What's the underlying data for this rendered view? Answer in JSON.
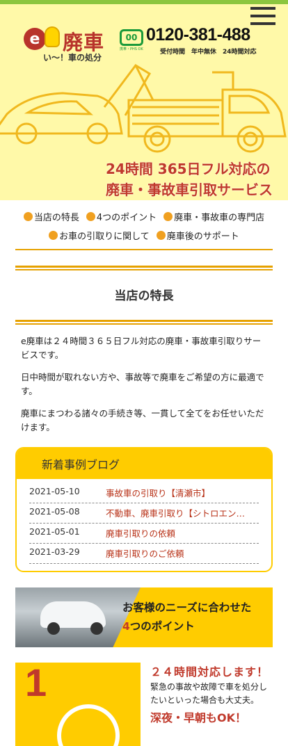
{
  "header": {
    "logo_letter": "e",
    "logo_word": "廃車",
    "logo_tagline": "い～！車の処分",
    "freedial_mark": "00",
    "freedial_sub": "携帯・PHS OK",
    "phone": "0120-381-488",
    "hours": "受付時間　年中無休　24時間対応",
    "hero_line1": "24時間 365日フル対応の",
    "hero_line2": "廃車・事故車引取サービス"
  },
  "nav": {
    "row1": [
      "当店の特長",
      "4つのポイント",
      "廃車・事故車の専門店"
    ],
    "row2": [
      "お車の引取りに関して",
      "廃車後のサポート"
    ]
  },
  "features": {
    "heading": "当店の特長",
    "paragraphs": [
      "e廃車は２４時間３６５日フル対応の廃車・事故車引取りサービスです。",
      "日中時間が取れない方や、事故等で廃車をご希望の方に最適です。",
      "廃車にまつわる諸々の手続き等、一貫して全てをお任せいただけます。"
    ]
  },
  "blog": {
    "heading": "新着事例ブログ",
    "entries": [
      {
        "date": "2021-05-10",
        "title": "事故車の引取り【清瀬市】"
      },
      {
        "date": "2021-05-08",
        "title": "不動車、廃車引取り【シトロエン…"
      },
      {
        "date": "2021-05-01",
        "title": "廃車引取りの依頼"
      },
      {
        "date": "2021-03-29",
        "title": "廃車引取りのご依頼"
      }
    ]
  },
  "banner": {
    "line1": "お客様のニーズに合わせた",
    "num": "4",
    "line2_rest": "つのポイント"
  },
  "point1": {
    "number": "1",
    "title": "２４時間対応します！",
    "desc": "緊急の事故や故障で車を処分したいといった場合も大丈夫。",
    "sub": "深夜・早朝もOK！"
  },
  "colors": {
    "accent": "#ffcc00",
    "brand_red": "#c0392b",
    "hero_bg": "#fff9a8",
    "top_stripe": "#8cc63f"
  }
}
